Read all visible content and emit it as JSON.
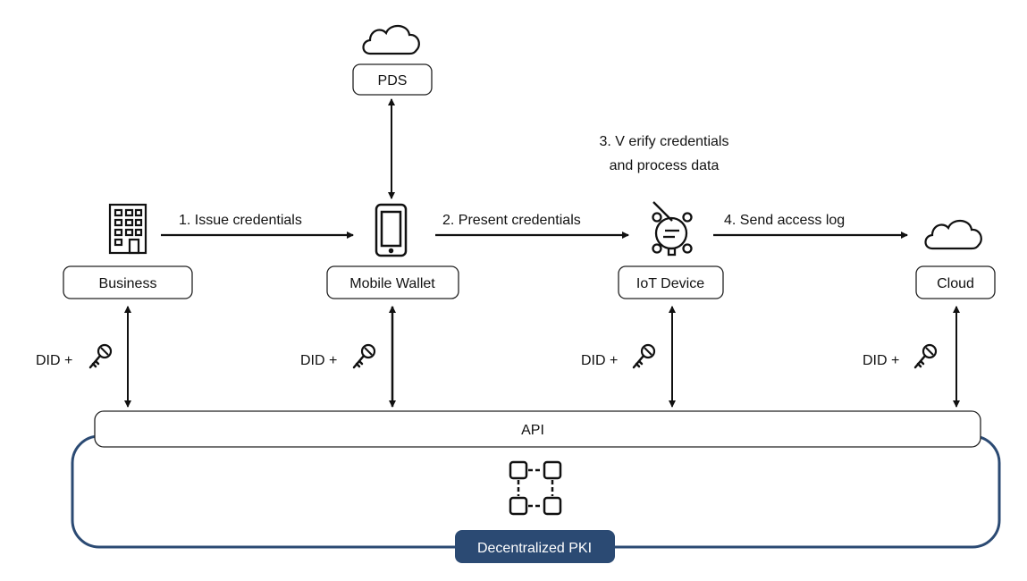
{
  "nodes": {
    "pds": "PDS",
    "business": "Business",
    "mobile_wallet": "Mobile Wallet",
    "iot_device": "IoT Device",
    "cloud": "Cloud",
    "api": "API",
    "pki": "Decentralized PKI"
  },
  "edges": {
    "issue": "1. Issue credentials",
    "present": "2. Present credentials",
    "verify_line1": "3. V erify credentials",
    "verify_line2": "and process data",
    "send_log": "4. Send access log"
  },
  "did_labels": [
    "DID +",
    "DID +",
    "DID +",
    "DID +"
  ],
  "icons": [
    "cloud-icon",
    "building-icon",
    "phone-icon",
    "iot-device-icon",
    "key-icon",
    "blockchain-icon"
  ],
  "colors": {
    "pki": "#2b4a73",
    "line": "#111111"
  }
}
